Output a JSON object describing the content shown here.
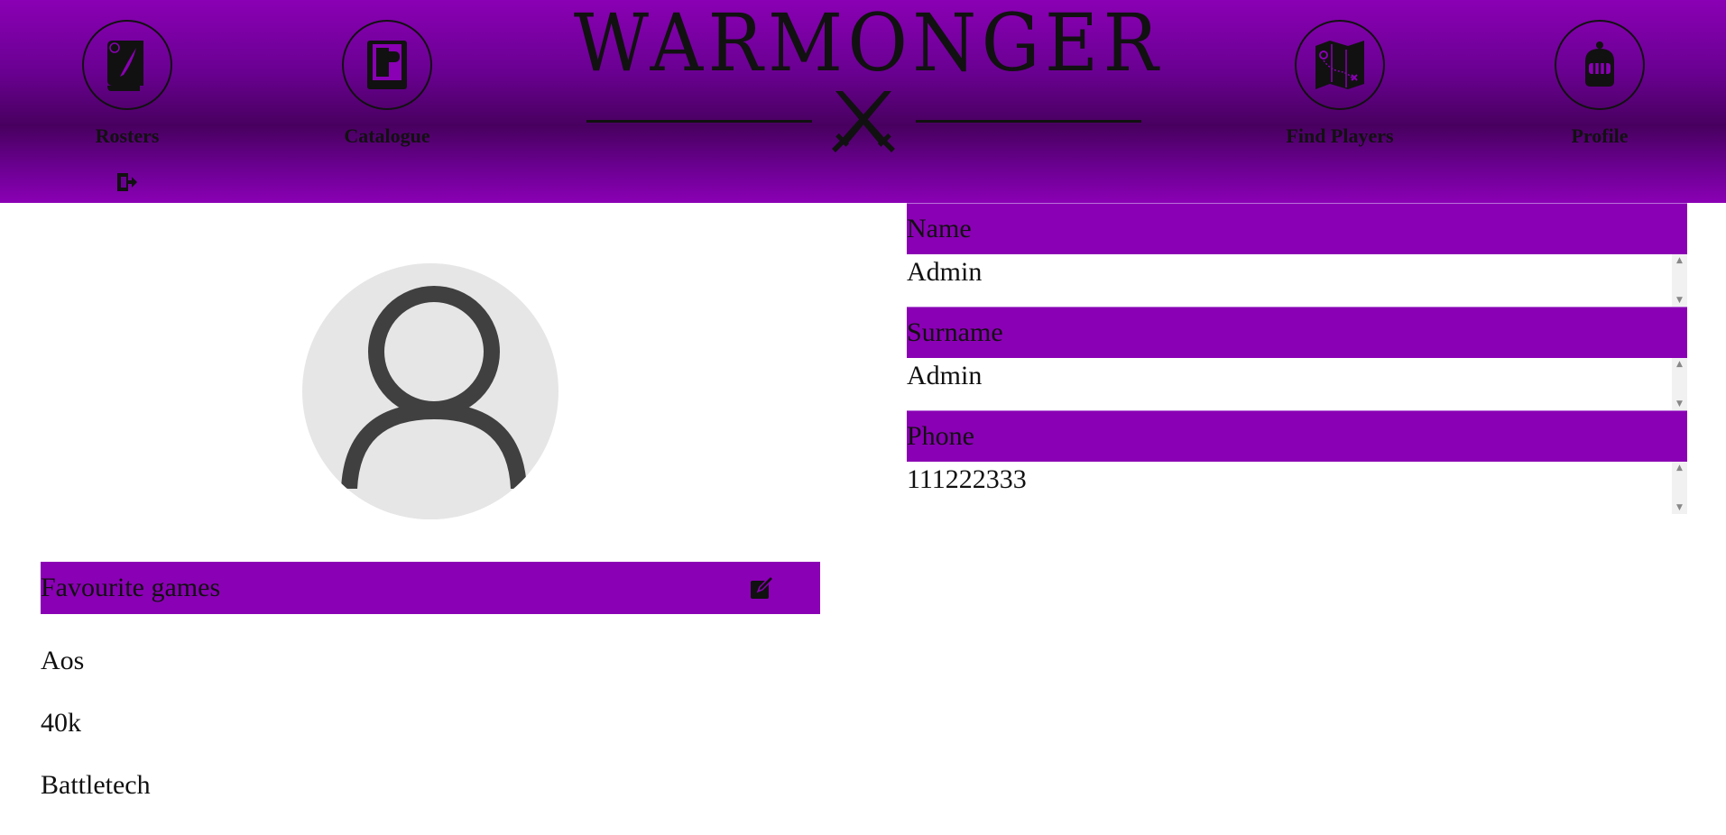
{
  "header": {
    "logo_title": "WARMONGER",
    "nav": [
      {
        "label": "Rosters",
        "icon": "scroll-quill-icon"
      },
      {
        "label": "Catalogue",
        "icon": "book-icon"
      },
      {
        "label": "Find Players",
        "icon": "map-icon"
      },
      {
        "label": "Profile",
        "icon": "knight-helmet-icon"
      }
    ],
    "logout_icon": "logout-icon",
    "colors": {
      "brand": "#8a00b4",
      "dark": "#48005f"
    }
  },
  "profile": {
    "favourite_games_label": "Favourite games",
    "favourite_games": [
      "Aos",
      "40k",
      "Battletech"
    ],
    "fields": [
      {
        "label": "Name",
        "value": "Admin"
      },
      {
        "label": "Surname",
        "value": "Admin"
      },
      {
        "label": "Phone",
        "value": "111222333"
      }
    ]
  }
}
